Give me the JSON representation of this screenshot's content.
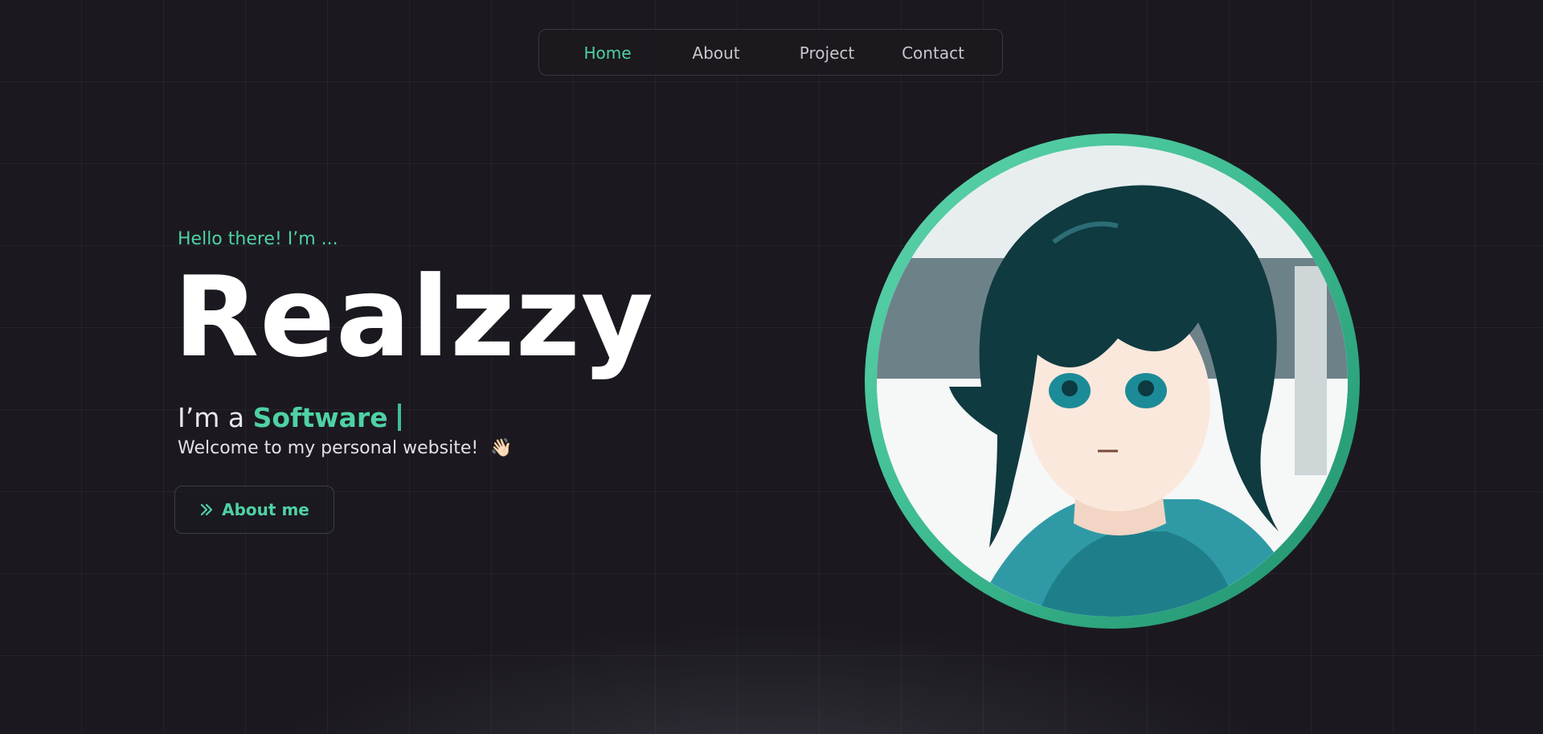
{
  "nav": {
    "items": [
      {
        "label": "Home",
        "active": true
      },
      {
        "label": "About",
        "active": false
      },
      {
        "label": "Project",
        "active": false
      },
      {
        "label": "Contact",
        "active": false
      }
    ]
  },
  "hero": {
    "greeting": "Hello there! I’m ...",
    "name": "Realzzy",
    "role_prefix": "I’m a",
    "role_highlight": "Software",
    "welcome": "Welcome to my personal website!",
    "wave_emoji": "👋🏻",
    "button_label": "About me",
    "button_icon": "double-chevron-right-icon"
  },
  "avatar": {
    "description_icon": "anime-avatar-icon"
  },
  "colors": {
    "accent": "#4fd1a5",
    "background": "#1b191f",
    "text": "#ffffff",
    "muted": "#c9c7cc"
  }
}
